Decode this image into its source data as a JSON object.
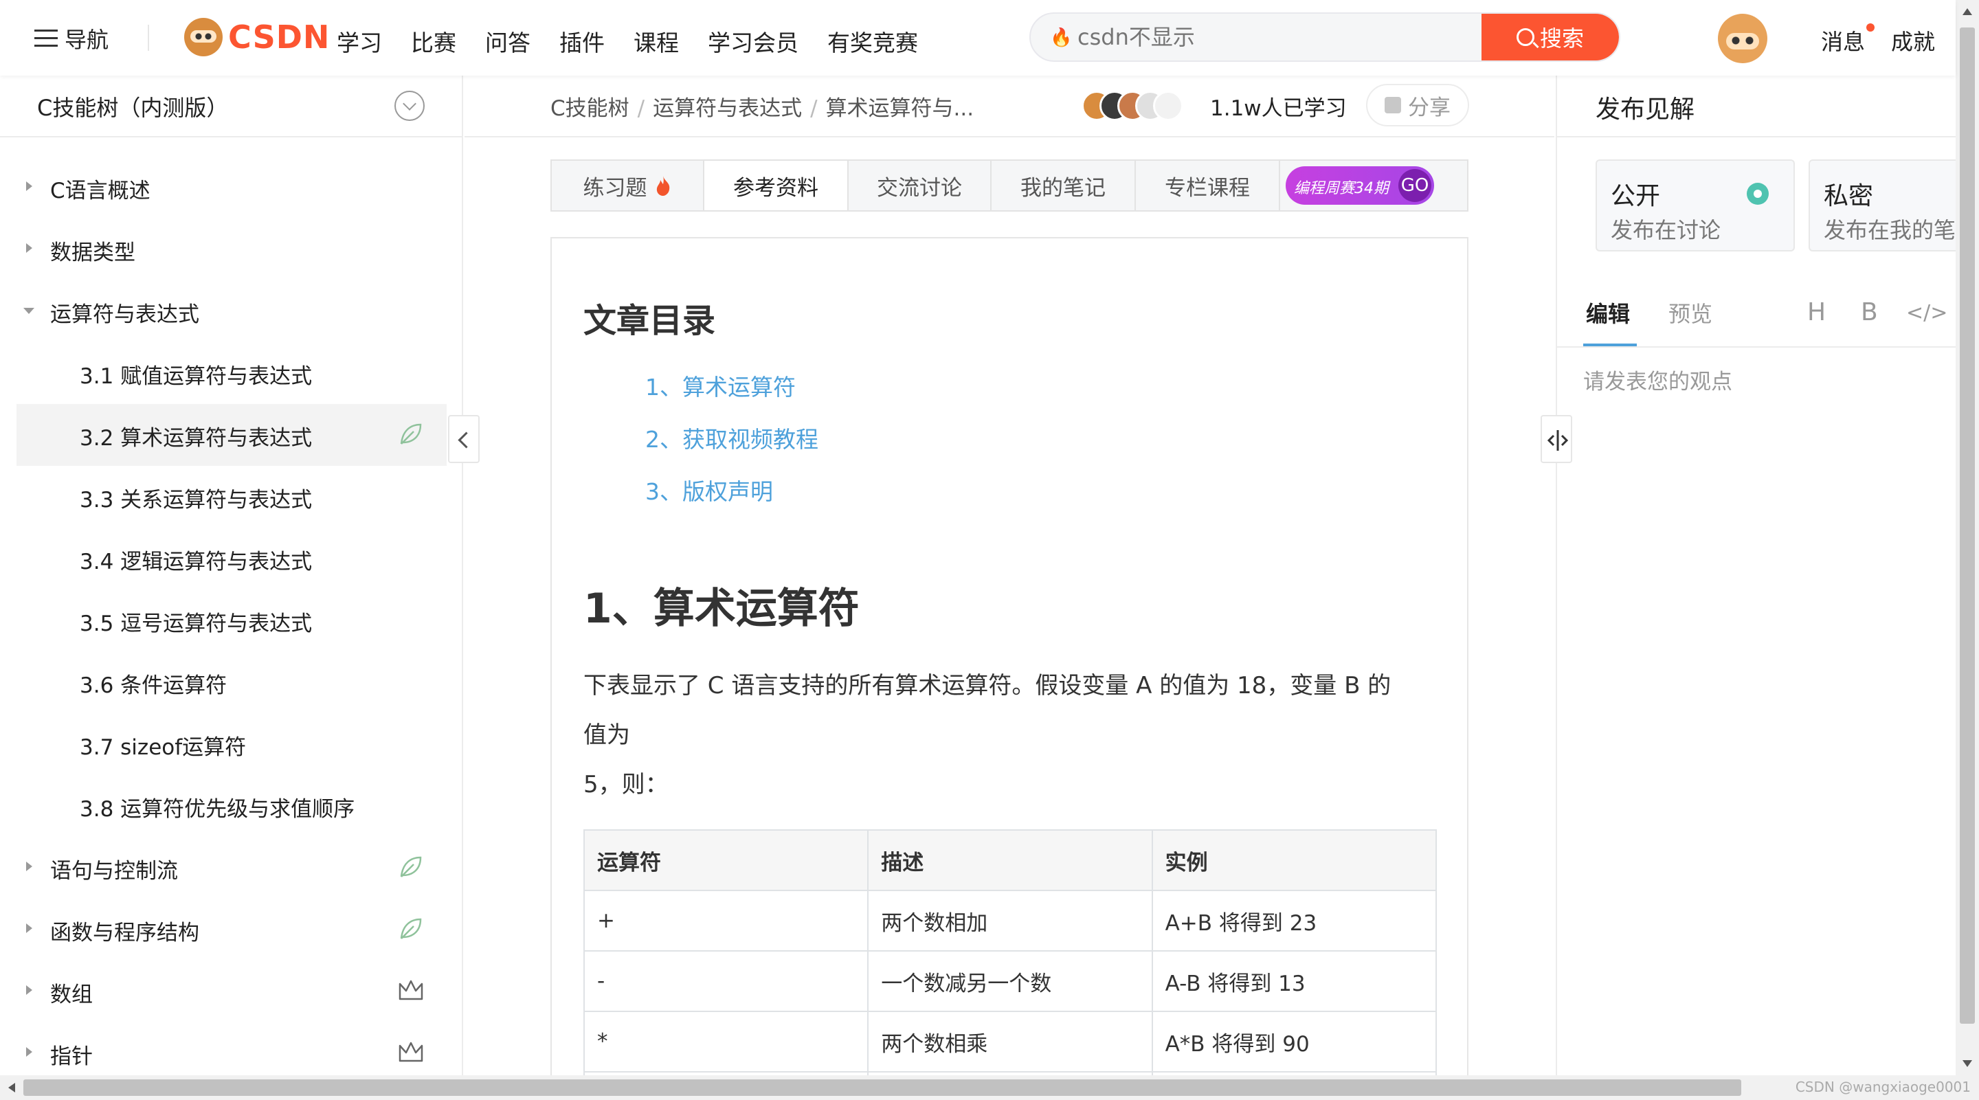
{
  "topbar": {
    "nav_label": "导航",
    "logo_text": "CSDN",
    "main_nav": [
      "学习",
      "比赛",
      "问答",
      "插件",
      "课程",
      "学习会员",
      "有奖竞赛"
    ],
    "search_placeholder": "csdn不显示",
    "search_button": "搜索",
    "messages": "消息",
    "achievements": "成就"
  },
  "sidebar": {
    "title": "C技能树（内测版）",
    "items": [
      {
        "label": "C语言概述",
        "level": "top",
        "state": "collapsed"
      },
      {
        "label": "数据类型",
        "level": "top",
        "state": "collapsed"
      },
      {
        "label": "运算符与表达式",
        "level": "top",
        "state": "expanded"
      },
      {
        "label": "3.1 赋值运算符与表达式",
        "level": "sub"
      },
      {
        "label": "3.2 算术运算符与表达式",
        "level": "sub",
        "active": true,
        "icon": "leaf-icon"
      },
      {
        "label": "3.3 关系运算符与表达式",
        "level": "sub"
      },
      {
        "label": "3.4 逻辑运算符与表达式",
        "level": "sub"
      },
      {
        "label": "3.5 逗号运算符与表达式",
        "level": "sub"
      },
      {
        "label": "3.6 条件运算符",
        "level": "sub"
      },
      {
        "label": "3.7 sizeof运算符",
        "level": "sub"
      },
      {
        "label": "3.8 运算符优先级与求值顺序",
        "level": "sub"
      },
      {
        "label": "语句与控制流",
        "level": "top",
        "state": "collapsed",
        "icon": "leaf-icon"
      },
      {
        "label": "函数与程序结构",
        "level": "top",
        "state": "collapsed",
        "icon": "leaf-icon"
      },
      {
        "label": "数组",
        "level": "top",
        "state": "collapsed",
        "icon": "crown-icon"
      },
      {
        "label": "指针",
        "level": "top",
        "state": "collapsed",
        "icon": "crown-icon"
      }
    ]
  },
  "breadcrumb": {
    "items": [
      "C技能树",
      "运算符与表达式",
      "算术运算符与..."
    ],
    "learned": "1.1w人已学习",
    "share": "分享"
  },
  "tabs": [
    {
      "label": "练习题"
    },
    {
      "label": "参考资料"
    },
    {
      "label": "交流讨论"
    },
    {
      "label": "我的笔记"
    },
    {
      "label": "专栏课程"
    }
  ],
  "promo": {
    "text": "编程周赛34期",
    "go": "GO"
  },
  "article": {
    "toc_title": "文章目录",
    "toc": [
      "1、算术运算符",
      "2、获取视频教程",
      "3、版权声明"
    ],
    "heading": "1、算术运算符",
    "paragraph_lines": [
      "下表显示了 C 语言支持的所有算术运算符。假设变量 A 的值为 18，变量 B 的",
      "值为",
      "5，则："
    ],
    "table": {
      "headers": [
        "运算符",
        "描述",
        "实例"
      ],
      "rows": [
        [
          "+",
          "两个数相加",
          "A+B 将得到 23"
        ],
        [
          "-",
          "一个数减另一个数",
          "A-B 将得到 13"
        ],
        [
          "*",
          "两个数相乘",
          "A*B 将得到 90"
        ]
      ]
    }
  },
  "right_panel": {
    "title": "发布见解",
    "public_title": "公开",
    "public_sub": "发布在讨论",
    "private_title": "私密",
    "private_sub": "发布在我的笔记",
    "tab_edit": "编辑",
    "tab_preview": "预览",
    "tool_h": "H",
    "tool_b": "B",
    "tool_code": "</>",
    "placeholder": "请发表您的观点"
  },
  "watermark": "CSDN @wangxiaoge0001",
  "colors": {
    "brand": "#fc5531",
    "link": "#4ea1db",
    "accent_radio": "#4fc3b0",
    "promo": "#c640e0"
  }
}
